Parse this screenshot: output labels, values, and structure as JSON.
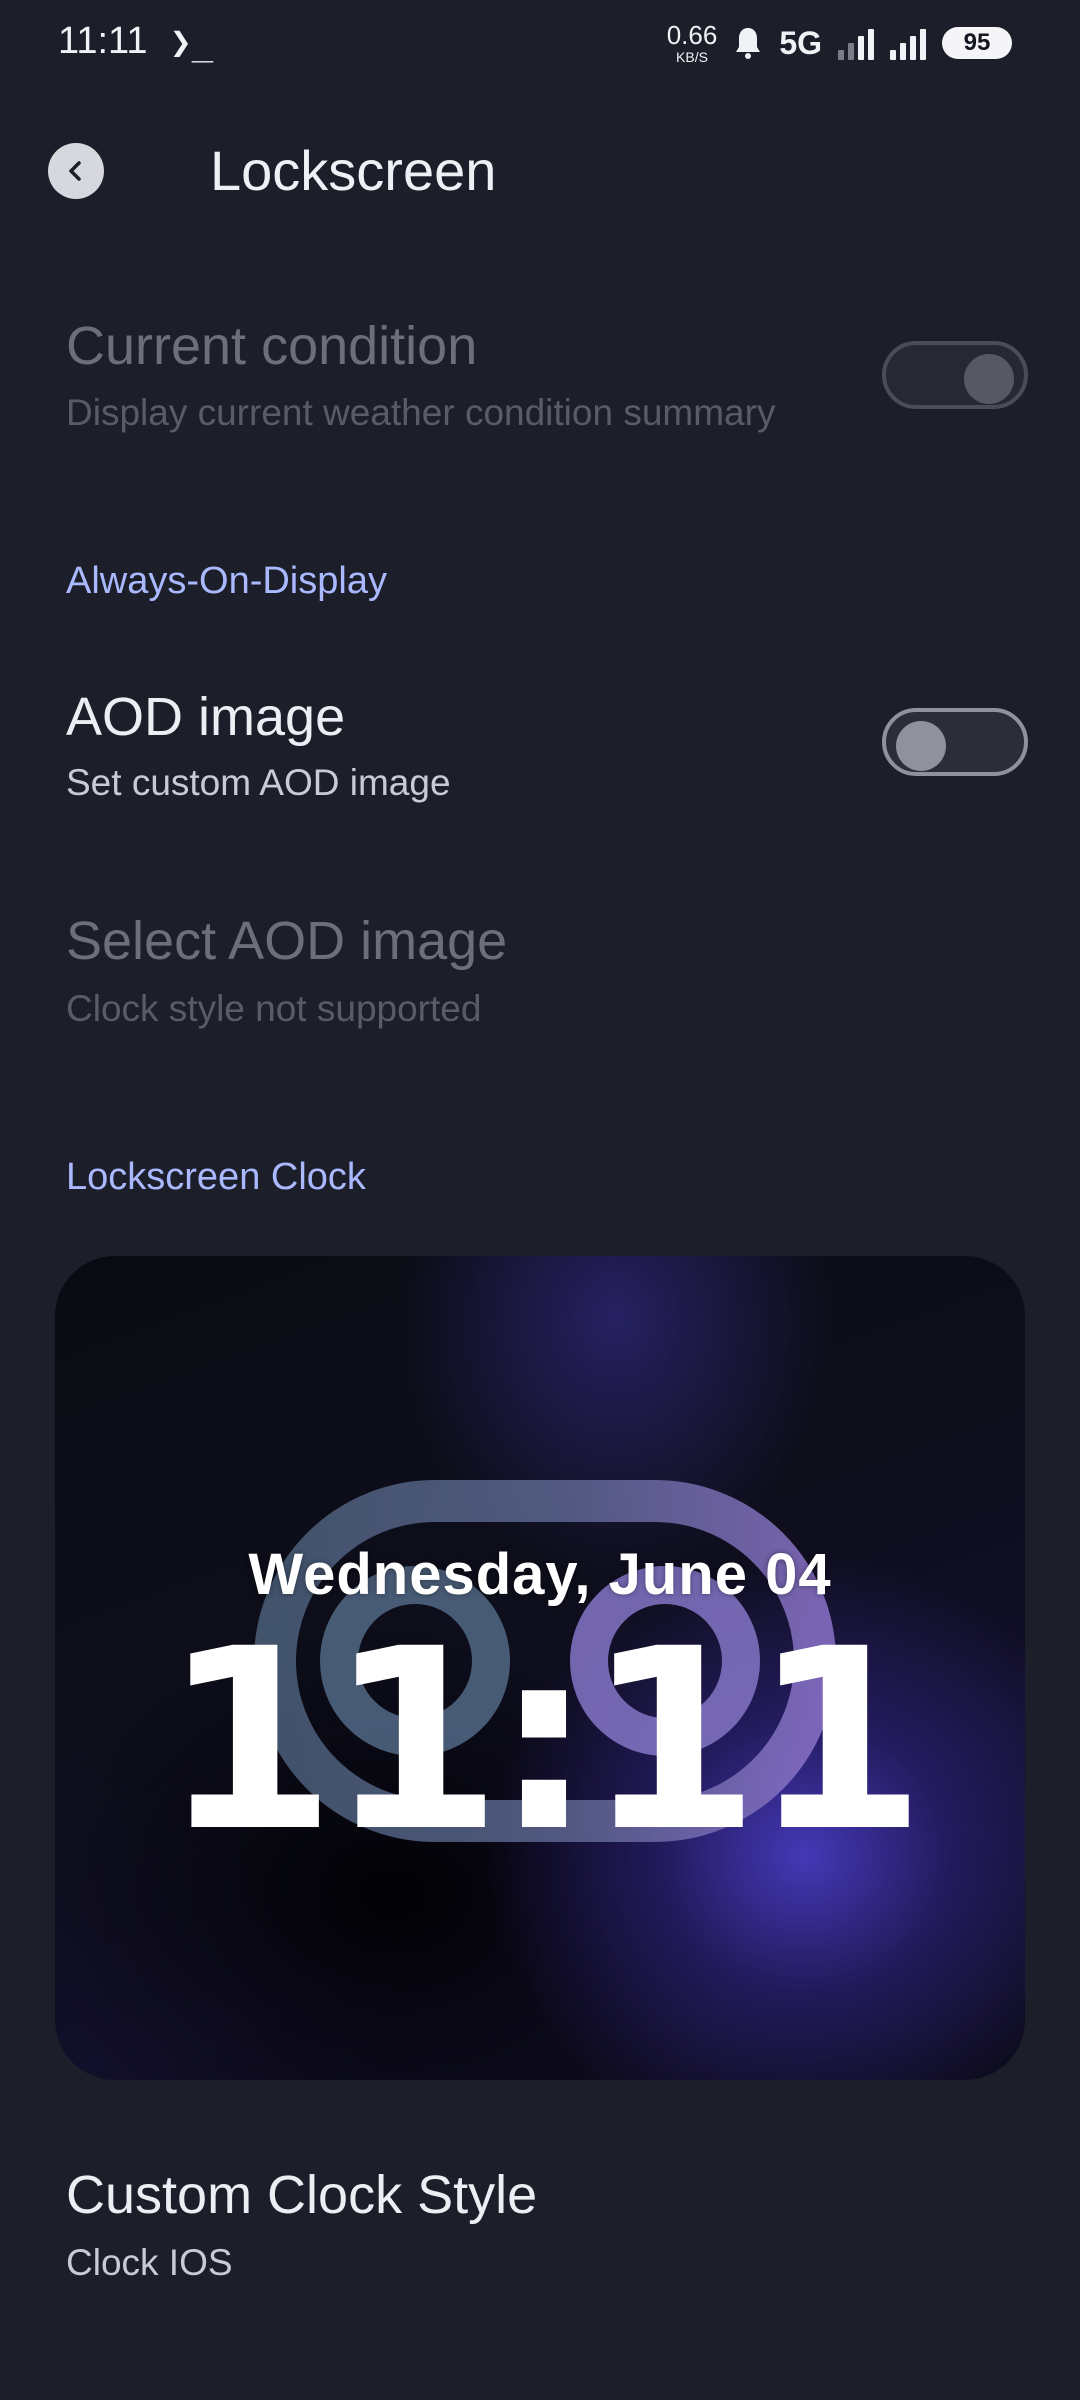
{
  "status_bar": {
    "time": "11:11",
    "terminal_symbol": "❯_",
    "net_speed_value": "0.66",
    "net_speed_unit": "KB/S",
    "notification_icon": "bell-icon",
    "network_type": "5G",
    "battery_level": "95"
  },
  "app_bar": {
    "back_icon": "chevron-left-icon",
    "title": "Lockscreen"
  },
  "weather": {
    "current_condition": {
      "title": "Current condition",
      "subtitle": "Display current weather condition summary",
      "enabled": false,
      "checked": true
    }
  },
  "aod_section": {
    "header": "Always-On-Display",
    "aod_image": {
      "title": "AOD image",
      "subtitle": "Set custom AOD image",
      "checked": false
    },
    "select_aod_image": {
      "title": "Select AOD image",
      "subtitle": "Clock style not supported",
      "enabled": false
    }
  },
  "clock_section": {
    "header": "Lockscreen Clock",
    "preview": {
      "date": "Wednesday, June 04",
      "time": "11:11"
    },
    "custom_clock_style": {
      "title": "Custom Clock Style",
      "subtitle": "Clock IOS"
    }
  },
  "colors": {
    "background": "#1c1f29",
    "section_accent": "#aab9ff"
  }
}
